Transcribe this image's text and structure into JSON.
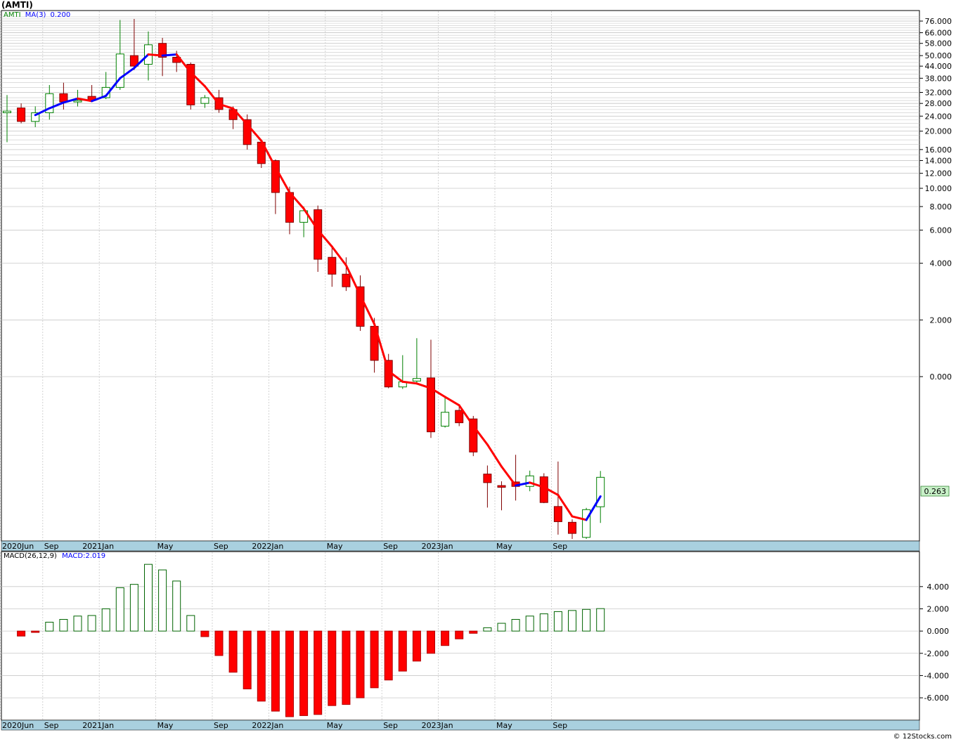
{
  "header": {
    "title": "(AMTI)",
    "price_legend_symbol": "AMTI",
    "price_legend_ma": "MA(3)",
    "price_legend_ma_value": "0.200",
    "macd_legend_label": "MACD(26,12,9)",
    "macd_legend_value": "MACD:2.019"
  },
  "footer": {
    "watermark": "© 12Stocks.com"
  },
  "colors": {
    "up_candle": "#008000",
    "down_candle": "#ff0000",
    "ma_up": "#0000ff",
    "ma_down": "#ff0000",
    "macd_pos": "#006400",
    "macd_neg": "#ff0000",
    "axis_band": "#a9d0df",
    "grid": "#c8c8c8",
    "last_price_box": "#c8f0c8"
  },
  "chart_data": [
    {
      "type": "candlestick",
      "title": "(AMTI)",
      "scale": "log",
      "months": [
        "2020-06",
        "2020-07",
        "2020-08",
        "2020-09",
        "2020-10",
        "2020-11",
        "2020-12",
        "2021-01",
        "2021-02",
        "2021-03",
        "2021-04",
        "2021-05",
        "2021-06",
        "2021-07",
        "2021-08",
        "2021-09",
        "2021-10",
        "2021-11",
        "2021-12",
        "2022-01",
        "2022-02",
        "2022-03",
        "2022-04",
        "2022-05",
        "2022-06",
        "2022-07",
        "2022-08",
        "2022-09",
        "2022-10",
        "2022-11",
        "2022-12",
        "2023-01",
        "2023-02",
        "2023-03",
        "2023-04",
        "2023-05",
        "2023-06",
        "2023-07",
        "2023-08",
        "2023-09",
        "2023-10",
        "2023-11",
        "2023-12"
      ],
      "ohlc": [
        [
          25,
          31,
          17.5,
          25.5
        ],
        [
          26.5,
          28,
          22,
          22.5
        ],
        [
          22.5,
          27,
          21,
          25
        ],
        [
          25,
          35,
          23,
          31.5
        ],
        [
          31.5,
          36,
          26,
          28.5
        ],
        [
          28.5,
          33,
          27,
          29
        ],
        [
          30.5,
          35,
          28.5,
          29
        ],
        [
          30,
          41,
          29.5,
          34
        ],
        [
          34,
          77,
          33,
          51
        ],
        [
          50,
          78,
          42,
          44
        ],
        [
          45,
          67,
          37,
          57
        ],
        [
          58,
          62,
          39,
          49
        ],
        [
          49,
          53,
          41,
          46
        ],
        [
          45,
          46,
          26,
          27.5
        ],
        [
          28,
          31,
          26.5,
          30
        ],
        [
          30,
          33,
          25,
          26
        ],
        [
          26,
          27,
          20.5,
          23
        ],
        [
          23,
          24.5,
          16,
          17
        ],
        [
          17.5,
          18,
          12.8,
          13.5
        ],
        [
          14,
          14.2,
          7.3,
          9.5
        ],
        [
          9.5,
          10.2,
          5.7,
          6.6
        ],
        [
          6.6,
          8.0,
          5.5,
          7.6
        ],
        [
          7.7,
          8.1,
          3.6,
          4.2
        ],
        [
          4.3,
          4.9,
          3.0,
          3.5
        ],
        [
          3.5,
          4.3,
          2.85,
          3.0
        ],
        [
          3.0,
          3.45,
          1.75,
          1.85
        ],
        [
          1.85,
          2.05,
          1.05,
          1.22
        ],
        [
          1.22,
          1.32,
          0.52,
          0.56
        ],
        [
          0.56,
          1.3,
          0.5,
          0.75
        ],
        [
          0.78,
          1.6,
          0.68,
          0.9
        ],
        [
          0.93,
          1.57,
          0.032,
          0.045
        ],
        [
          0.062,
          0.3,
          0.057,
          0.135
        ],
        [
          0.15,
          0.2,
          0.062,
          0.075
        ],
        [
          0.093,
          0.11,
          0.0115,
          0.0145
        ],
        [
          0.0042,
          0.0068,
          0.00064,
          0.0026
        ],
        [
          0.0022,
          0.0028,
          0.00055,
          0.002
        ],
        [
          0.0027,
          0.0124,
          0.00095,
          0.0021
        ],
        [
          0.0021,
          0.0051,
          0.0016,
          0.0038
        ],
        [
          0.0036,
          0.0044,
          0.00082,
          0.00085
        ],
        [
          0.00068,
          0.0085,
          0.00014,
          0.00029
        ],
        [
          0.00028,
          0.00033,
          0.00011,
          0.00015
        ],
        [
          0.00012,
          0.00063,
          0.00011,
          0.00057
        ],
        [
          0.00067,
          0.005,
          0.00027,
          0.0035
        ]
      ],
      "ma3": [
        null,
        null,
        24.3,
        26.4,
        28.3,
        29.7,
        28.8,
        30.7,
        38,
        43,
        50.7,
        50,
        50.7,
        40.8,
        34.5,
        27.8,
        26.3,
        21.7,
        17.8,
        12.9,
        9.5,
        7.8,
        6.0,
        4.9,
        3.9,
        2.7,
        1.9,
        1.07,
        0.75,
        0.68,
        0.52,
        0.32,
        0.2,
        0.063,
        0.022,
        0.0064,
        0.0022,
        0.0026,
        0.002,
        0.0013,
        0.00039,
        0.00032,
        0.0012
      ],
      "y_ticks": [
        "76.000",
        "66.000",
        "58.000",
        "50.000",
        "44.000",
        "38.000",
        "32.000",
        "28.000",
        "24.000",
        "20.000",
        "16.000",
        "14.000",
        "12.000",
        "10.000",
        "8.000",
        "6.000",
        "4.000",
        "2.000",
        "0.000"
      ],
      "last_price": "0.263",
      "x_labels": [
        {
          "text": "2020Jun",
          "month": "2020-06"
        },
        {
          "text": "Sep",
          "month": "2020-09"
        },
        {
          "text": "2021Jan",
          "month": "2021-01"
        },
        {
          "text": "May",
          "month": "2021-05"
        },
        {
          "text": "Sep",
          "month": "2021-09"
        },
        {
          "text": "2022Jan",
          "month": "2022-01"
        },
        {
          "text": "May",
          "month": "2022-05"
        },
        {
          "text": "Sep",
          "month": "2022-09"
        },
        {
          "text": "2023Jan",
          "month": "2023-01"
        },
        {
          "text": "May",
          "month": "2023-05"
        },
        {
          "text": "Sep",
          "month": "2023-09"
        }
      ],
      "grid": true
    },
    {
      "type": "bar",
      "title": "MACD(26,12,9)",
      "values": [
        0,
        -0.45,
        -0.12,
        0.8,
        1.05,
        1.35,
        1.4,
        2.0,
        3.9,
        4.2,
        6.0,
        5.5,
        4.5,
        1.4,
        -0.5,
        -2.2,
        -3.7,
        -5.2,
        -6.3,
        -7.2,
        -7.7,
        -7.6,
        -7.5,
        -6.7,
        -6.6,
        -6.0,
        -5.1,
        -4.4,
        -3.6,
        -2.7,
        -2.0,
        -1.3,
        -0.7,
        -0.2,
        0.3,
        0.7,
        1.05,
        1.35,
        1.55,
        1.75,
        1.85,
        1.95,
        2.02
      ],
      "ylim": [
        -7.7,
        6.2
      ],
      "y_ticks": [
        "4.000",
        "2.000",
        "0.000",
        "-2.000",
        "-4.000",
        "-6.000"
      ],
      "grid": true
    }
  ]
}
